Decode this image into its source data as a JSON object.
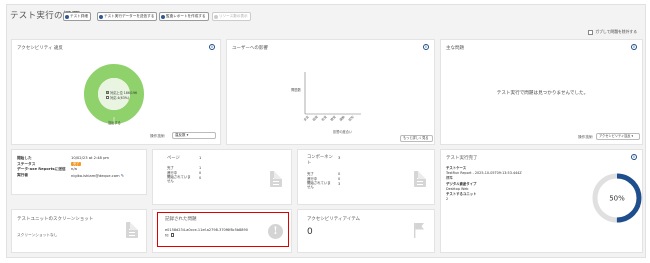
{
  "header": {
    "title": "テスト実行の概要",
    "buttons": [
      {
        "label": "テスト詳細",
        "enabled": true
      },
      {
        "label": "テスト実行データーを送信する",
        "enabled": true
      },
      {
        "label": "監査レポートを作成する",
        "enabled": true
      },
      {
        "label": "リソース数の表示",
        "enabled": false
      }
    ],
    "checkbox_label": "ガブして問題を除外する"
  },
  "accessibility_score": {
    "title": "アクセシビリティ 違反",
    "legend": [
      "対応上位 186/196",
      "対応 4(63%)"
    ],
    "donut_label": "違反する",
    "sort_label": "操作技術",
    "sort_value": "違反数 ▾",
    "ring_color": "#8fd16a",
    "inner_color": "#e9f5e1"
  },
  "user_impact": {
    "title": "ユーザーへの影響",
    "y_label": "問題数",
    "x_label": "影響の度合い",
    "x_ticks": [
      "全盲",
      "弱視",
      "色覚",
      "聴覚",
      "運動",
      "認知"
    ],
    "show_more": "もっと詳しく見る"
  },
  "key_issues": {
    "title": "主な問題",
    "message": "テスト実行で問題は見つかりませんでした。",
    "sort_label": "操作技術",
    "sort_value": "アクセシビリティ違反 ▾"
  },
  "run_info": {
    "rows": [
      {
        "key": "開始した",
        "value": "10/02/23 at 2:48 pm"
      },
      {
        "key": "ステータス",
        "value": "完了"
      },
      {
        "key": "データ-axe Reportsに送信",
        "value": "n/a"
      },
      {
        "key": "実行者",
        "value": "nigiko.ishiam@deque.com"
      }
    ]
  },
  "pages": {
    "title": "ページ",
    "total": "1",
    "rows": [
      {
        "label": "完了",
        "value": "1"
      },
      {
        "label": "進行中",
        "value": "0"
      },
      {
        "label": "開始されていません",
        "value": "0"
      }
    ]
  },
  "components": {
    "title": "コンポーネント",
    "total": "3",
    "rows": [
      {
        "label": "完了",
        "value": "0"
      },
      {
        "label": "進行中",
        "value": "0"
      },
      {
        "label": "開始されていません",
        "value": "3"
      }
    ]
  },
  "test_progress": {
    "title": "テスト実行完了",
    "rows": [
      {
        "key": "テストケース",
        "value": "TestRun Report - 2025-10-05T09:13:53.444Z"
      },
      {
        "key": "",
        "value": "標準"
      },
      {
        "key": "デジタル資産タイプ",
        "value": "Desktop Web"
      },
      {
        "key": "テストするユニット",
        "value": "2"
      }
    ],
    "percent_label": "50%",
    "percent": 0.5,
    "ring_color": "#1f4e8c",
    "track_color": "#e0e0e0"
  },
  "screenshots": {
    "title": "テストユニットのスクリーンショット",
    "empty": "スクリーンショットなし"
  },
  "recorded_issues": {
    "title": "記録された問題",
    "issue_id": "e0158d234-a0cce-11ef-a2798-370f6f8c5b8890fd",
    "highlight_color": "#e00000"
  },
  "action_items": {
    "title": "アクセシビリティアイテム",
    "count": "0"
  }
}
